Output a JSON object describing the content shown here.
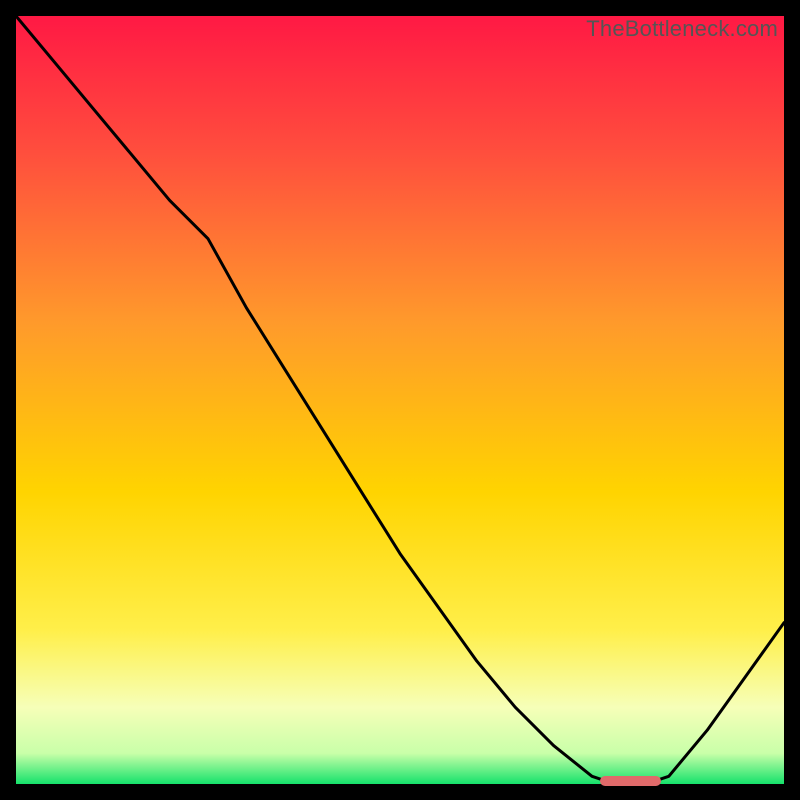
{
  "attribution": "TheBottleneck.com",
  "colors": {
    "gradient_top": "#ff1944",
    "gradient_mid1": "#ff7a2e",
    "gradient_mid2": "#ffd400",
    "gradient_yellow": "#ffef4a",
    "gradient_pale": "#f6ffb8",
    "gradient_green": "#15e26b",
    "line": "#000000",
    "marker": "#e06a6a",
    "background": "#000000"
  },
  "chart_data": {
    "type": "line",
    "title": "",
    "xlabel": "",
    "ylabel": "",
    "xlim": [
      0,
      100
    ],
    "ylim": [
      0,
      100
    ],
    "grid": false,
    "legend": false,
    "series": [
      {
        "name": "bottleneck-curve",
        "x": [
          0,
          5,
          10,
          15,
          20,
          25,
          30,
          35,
          40,
          45,
          50,
          55,
          60,
          65,
          70,
          75,
          78,
          80,
          82,
          85,
          90,
          95,
          100
        ],
        "y": [
          100,
          94,
          88,
          82,
          76,
          71,
          62,
          54,
          46,
          38,
          30,
          23,
          16,
          10,
          5,
          1,
          0,
          0,
          0,
          1,
          7,
          14,
          21
        ]
      }
    ],
    "annotations": [
      {
        "name": "optimal-marker",
        "shape": "pill",
        "x_start": 76,
        "x_end": 84,
        "y": 0,
        "color": "#e06a6a"
      }
    ]
  }
}
